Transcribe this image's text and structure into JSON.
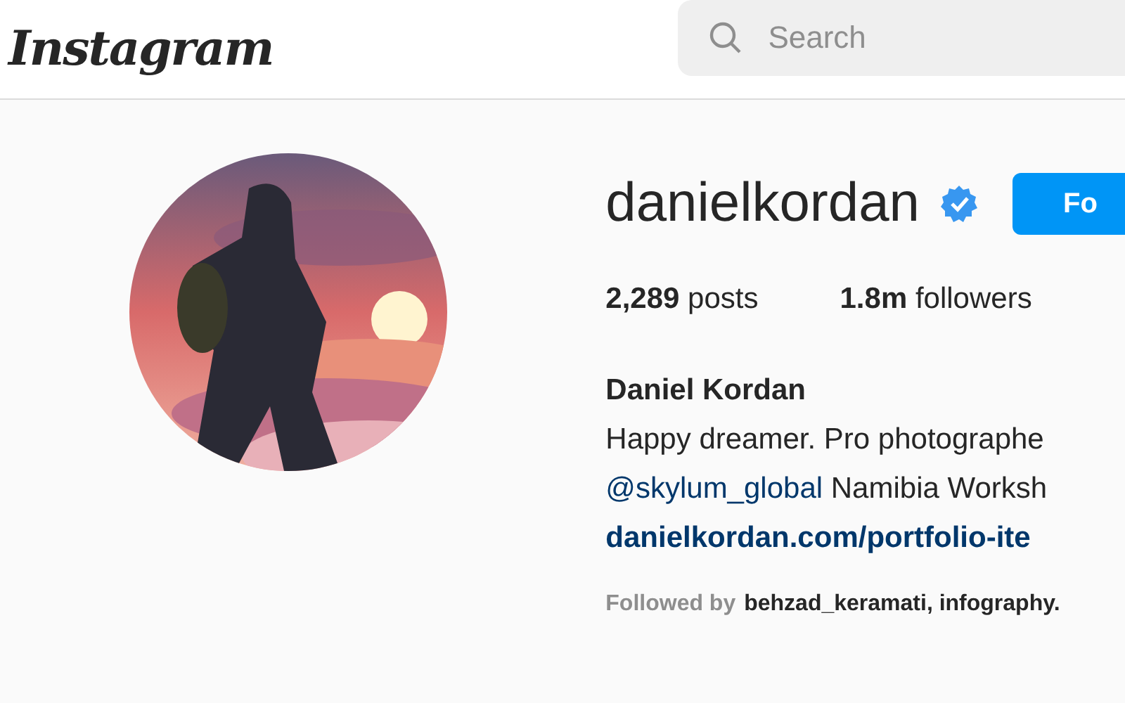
{
  "header": {
    "logo": "Instagram",
    "search": {
      "placeholder": "Search"
    }
  },
  "profile": {
    "username": "danielkordan",
    "verified": true,
    "follow_button": "Fo",
    "stats": [
      "**2,289** posts",
      "**1.8m** followers"
    ],
    "full_name": "Daniel Kordan",
    "bio": "Happy dreamer. Pro photographe",
    "mention_line": {
      "mention": "@skylum_global",
      "text": "Namibia Worksh"
    },
    "link": "danielkordan.com/portfolio-ite",
    "followed_by": {
      "label": "Followed by",
      "names": "behzad_keramati, infography."
    }
  }
}
